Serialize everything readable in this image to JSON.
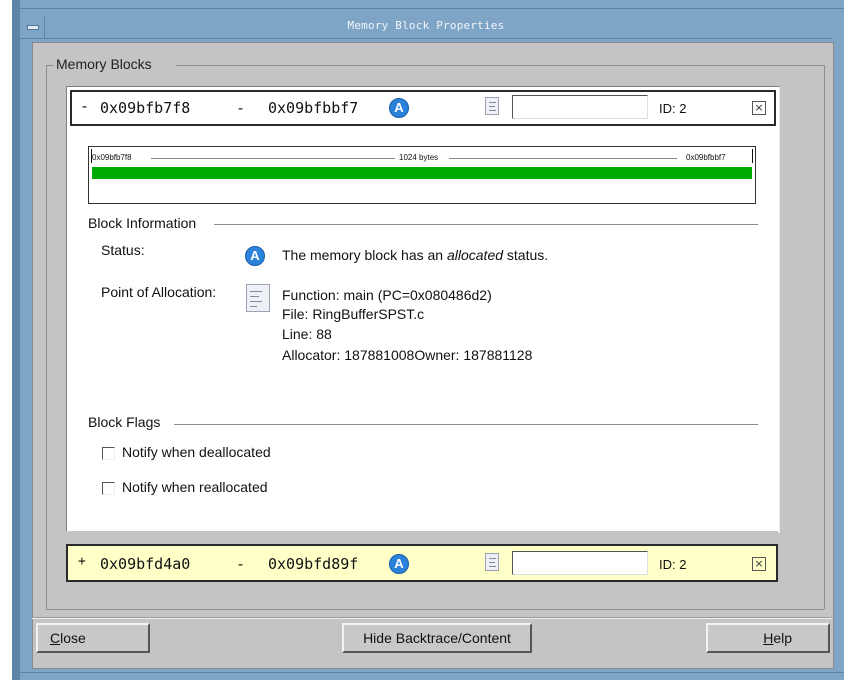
{
  "window": {
    "title": "Memory Block Properties"
  },
  "group": {
    "label": "Memory Blocks"
  },
  "block1": {
    "toggle": "-",
    "start": "0x09bfb7f8",
    "sep": "-",
    "end": "0x09bfbbf7",
    "status_icon": "allocated-icon",
    "id_label": "ID: 2",
    "close_icon": "close-icon",
    "map": {
      "start": "0x09bfb7f8",
      "size": "1024 bytes",
      "end": "0x09bfbbf7",
      "bar_color": "#00aa00",
      "fill_fraction": 1.0
    },
    "info": {
      "label": "Block Information",
      "status_label": "Status:",
      "status_prefix": "The memory block has an ",
      "status_word": "allocated",
      "status_suffix": " status.",
      "poa_label": "Point of Allocation:",
      "function_line": "Function: main (PC=0x080486d2)",
      "file_line": "File: RingBufferSPST.c",
      "line_line": "Line: 88",
      "allocator_line": "Allocator: 187881008Owner: 187881128"
    },
    "flags": {
      "label": "Block Flags",
      "dealloc": "Notify when deallocated",
      "realloc": "Notify when reallocated"
    }
  },
  "block2": {
    "toggle": "+",
    "start": "0x09bfd4a0",
    "sep": "-",
    "end": "0x09bfd89f",
    "id_label": "ID: 2"
  },
  "buttons": {
    "close_u": "C",
    "close_rest": "lose",
    "hide": "Hide Backtrace/Content",
    "help_u": "H",
    "help_rest": "elp"
  },
  "colors": {
    "accent": "#7fa5c6",
    "highlight": "#ffffc8",
    "bar": "#00aa00"
  }
}
